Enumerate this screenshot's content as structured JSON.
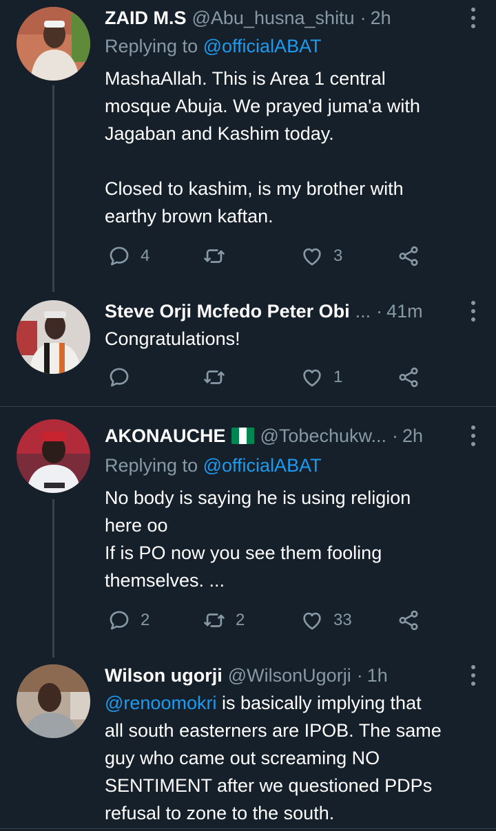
{
  "tweets": [
    {
      "name": "ZAID M.S",
      "handle": "@Abu_husna_shitu",
      "time": "2h",
      "replying_prefix": "Replying to",
      "replying_to": "@officialABAT",
      "body_lines": [
        "MashaAllah. This is Area 1 central",
        "mosque Abuja. We prayed juma'a with",
        "Jagaban and Kashim today.",
        "",
        "Closed to kashim, is my brother with",
        "earthy brown kaftan."
      ],
      "replies": "4",
      "retweets": "",
      "likes": "3",
      "avatar_colors": [
        "#c9795a",
        "#e9e3dc"
      ]
    },
    {
      "name": "Steve Orji Mcfedo Peter Obi",
      "handle": "...",
      "time": "41m",
      "body_lines": [
        "Congratulations!"
      ],
      "replies": "",
      "retweets": "",
      "likes": "1",
      "avatar_colors": [
        "#d9d4cf",
        "#3d2a24"
      ]
    },
    {
      "name": "AKONAUCHE",
      "flag_colors": [
        "#008751",
        "#ffffff",
        "#008751"
      ],
      "handle": "@Tobechukw...",
      "time": "2h",
      "replying_prefix": "Replying to",
      "replying_to": "@officialABAT",
      "body_lines": [
        "No body is saying he is using religion",
        "here oo",
        "If is PO now you see them fooling",
        "themselves. ..."
      ],
      "replies": "2",
      "retweets": "2",
      "likes": "33",
      "avatar_colors": [
        "#b22b3a",
        "#2f2a30"
      ]
    },
    {
      "name": "Wilson ugorji",
      "handle": "@WilsonUgorji",
      "time": "1h",
      "mention": "@renoomokri",
      "body_first_rest": " is basically implying that",
      "body_lines": [
        "all south easterners are IPOB. The same",
        "guy who came out screaming NO",
        "SENTIMENT after we questioned PDPs",
        "refusal to zone to the south."
      ],
      "avatar_colors": [
        "#8c6a52",
        "#3e2a20"
      ]
    }
  ],
  "theme": {
    "background": "#15202b",
    "muted": "#8899a6",
    "link": "#1d9bf0",
    "divider": "#38444d"
  }
}
